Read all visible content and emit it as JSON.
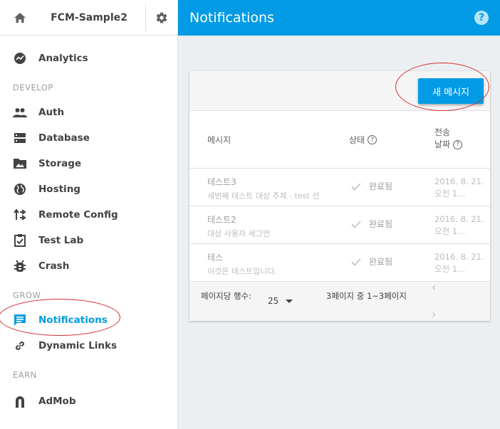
{
  "sidebar": {
    "project_name": "FCM-Sample2",
    "items": [
      {
        "label": "Analytics",
        "icon": "analytics-icon"
      },
      {
        "section": "DEVELOP"
      },
      {
        "label": "Auth",
        "icon": "people-icon"
      },
      {
        "label": "Database",
        "icon": "database-icon"
      },
      {
        "label": "Storage",
        "icon": "storage-icon"
      },
      {
        "label": "Hosting",
        "icon": "globe-icon"
      },
      {
        "label": "Remote Config",
        "icon": "remote-config-icon"
      },
      {
        "label": "Test Lab",
        "icon": "test-lab-icon"
      },
      {
        "label": "Crash",
        "icon": "bug-icon"
      },
      {
        "section": "GROW"
      },
      {
        "label": "Notifications",
        "icon": "chat-icon",
        "active": true
      },
      {
        "label": "Dynamic Links",
        "icon": "link-icon"
      },
      {
        "section": "EARN"
      },
      {
        "label": "AdMob",
        "icon": "admob-icon"
      }
    ]
  },
  "header": {
    "title": "Notifications",
    "help": "?"
  },
  "card": {
    "new_message_label": "새 메시지",
    "columns": {
      "message": "메시지",
      "status": "상태",
      "sent_date_line1": "전송",
      "sent_date_line2": "날짜",
      "help": "?"
    },
    "rows": [
      {
        "title": "테스트3",
        "subtitle": "세번째 테스트 대상 주제 - test 선",
        "status": "완료됨",
        "date1": "2016. 8. 21.",
        "date2": "오전 1..."
      },
      {
        "title": "테스트2",
        "subtitle": "대상 사용자 세그먼",
        "status": "완료됨",
        "date1": "2016. 8. 21.",
        "date2": "오전 1..."
      },
      {
        "title": "테스",
        "subtitle": "이것은 테스트입니다.",
        "status": "완료됨",
        "date1": "2016. 8. 21.",
        "date2": "오전 1..."
      }
    ],
    "footer": {
      "rows_per_page_label": "페이지당 행수:",
      "rows_per_page_value": "25",
      "page_range": "3페이지 중 1~3페이지",
      "prev": "‹",
      "next": "›"
    }
  },
  "colors": {
    "primary": "#039be5",
    "annotation": "#d32f2f"
  }
}
